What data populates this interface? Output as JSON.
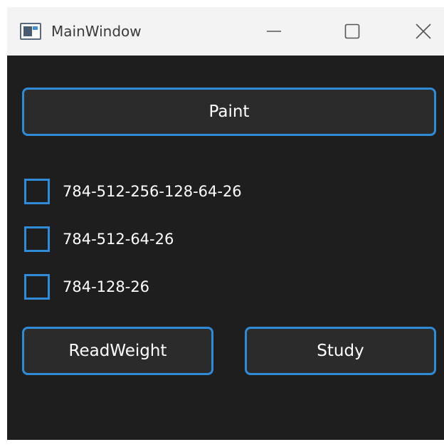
{
  "window": {
    "title": "MainWindow",
    "controls": {
      "minimize_icon": "minimize-icon",
      "maximize_icon": "maximize-icon",
      "close_icon": "close-icon"
    }
  },
  "main": {
    "paint_label": "Paint",
    "checkboxes": [
      {
        "label": "784-512-256-128-64-26",
        "checked": false
      },
      {
        "label": "784-512-64-26",
        "checked": false
      },
      {
        "label": "784-128-26",
        "checked": false
      }
    ],
    "read_weight_label": "ReadWeight",
    "study_label": "Study"
  },
  "colors": {
    "accent": "#2f8ad8",
    "background": "#1e1e1e",
    "button_fill": "#2b2b2b",
    "titlebar": "#f3f3f3",
    "text": "#ffffff"
  }
}
